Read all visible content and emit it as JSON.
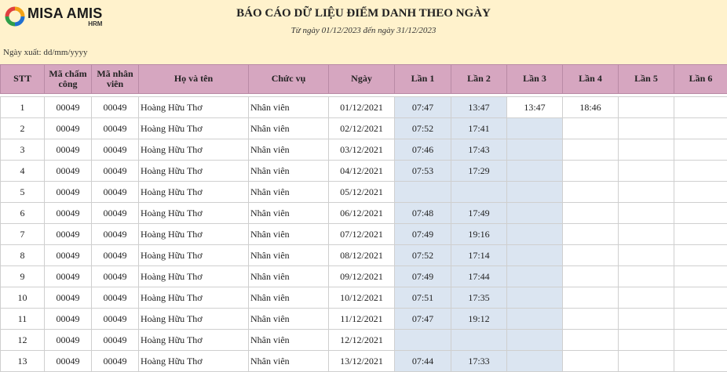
{
  "brand": {
    "name": "MISA AMIS",
    "sub": "HRM"
  },
  "report": {
    "title": "BÁO CÁO DỮ LIỆU ĐIỂM DANH THEO NGÀY",
    "subtitle": "Từ ngày 01/12/2023 đến ngày 31/12/2023",
    "export_label": "Ngày xuất: dd/mm/yyyy"
  },
  "table": {
    "headers": [
      "STT",
      "Mã chấm công",
      "Mã nhân viên",
      "Họ và tên",
      "Chức vụ",
      "Ngày",
      "Lần 1",
      "Lần 2",
      "Lần 3",
      "Lần 4",
      "Lần 5",
      "Lần 6"
    ],
    "rows": [
      [
        "1",
        "00049",
        "00049",
        "Hoàng Hữu Thơ",
        "Nhân viên",
        "01/12/2021",
        "07:47",
        "13:47",
        "13:47",
        "18:46",
        "",
        ""
      ],
      [
        "2",
        "00049",
        "00049",
        "Hoàng Hữu Thơ",
        "Nhân viên",
        "02/12/2021",
        "07:52",
        "17:41",
        "",
        "",
        "",
        ""
      ],
      [
        "3",
        "00049",
        "00049",
        "Hoàng Hữu Thơ",
        "Nhân viên",
        "03/12/2021",
        "07:46",
        "17:43",
        "",
        "",
        "",
        ""
      ],
      [
        "4",
        "00049",
        "00049",
        "Hoàng Hữu Thơ",
        "Nhân viên",
        "04/12/2021",
        "07:53",
        "17:29",
        "",
        "",
        "",
        ""
      ],
      [
        "5",
        "00049",
        "00049",
        "Hoàng Hữu Thơ",
        "Nhân viên",
        "05/12/2021",
        "",
        "",
        "",
        "",
        "",
        ""
      ],
      [
        "6",
        "00049",
        "00049",
        "Hoàng Hữu Thơ",
        "Nhân viên",
        "06/12/2021",
        "07:48",
        "17:49",
        "",
        "",
        "",
        ""
      ],
      [
        "7",
        "00049",
        "00049",
        "Hoàng Hữu Thơ",
        "Nhân viên",
        "07/12/2021",
        "07:49",
        "19:16",
        "",
        "",
        "",
        ""
      ],
      [
        "8",
        "00049",
        "00049",
        "Hoàng Hữu Thơ",
        "Nhân viên",
        "08/12/2021",
        "07:52",
        "17:14",
        "",
        "",
        "",
        ""
      ],
      [
        "9",
        "00049",
        "00049",
        "Hoàng Hữu Thơ",
        "Nhân viên",
        "09/12/2021",
        "07:49",
        "17:44",
        "",
        "",
        "",
        ""
      ],
      [
        "10",
        "00049",
        "00049",
        "Hoàng Hữu Thơ",
        "Nhân viên",
        "10/12/2021",
        "07:51",
        "17:35",
        "",
        "",
        "",
        ""
      ],
      [
        "11",
        "00049",
        "00049",
        "Hoàng Hữu Thơ",
        "Nhân viên",
        "11/12/2021",
        "07:47",
        "19:12",
        "",
        "",
        "",
        ""
      ],
      [
        "12",
        "00049",
        "00049",
        "Hoàng Hữu Thơ",
        "Nhân viên",
        "12/12/2021",
        "",
        "",
        "",
        "",
        "",
        ""
      ],
      [
        "13",
        "00049",
        "00049",
        "Hoàng Hữu Thơ",
        "Nhân viên",
        "13/12/2021",
        "07:44",
        "17:33",
        "",
        "",
        "",
        ""
      ]
    ]
  },
  "colors": {
    "header_bg": "#fff2cc",
    "table_header": "#d6a6c0",
    "highlight": "#dbe5f1",
    "logo_green": "#2e9e4a",
    "logo_blue": "#1f6fd1",
    "logo_orange": "#f2a216"
  }
}
